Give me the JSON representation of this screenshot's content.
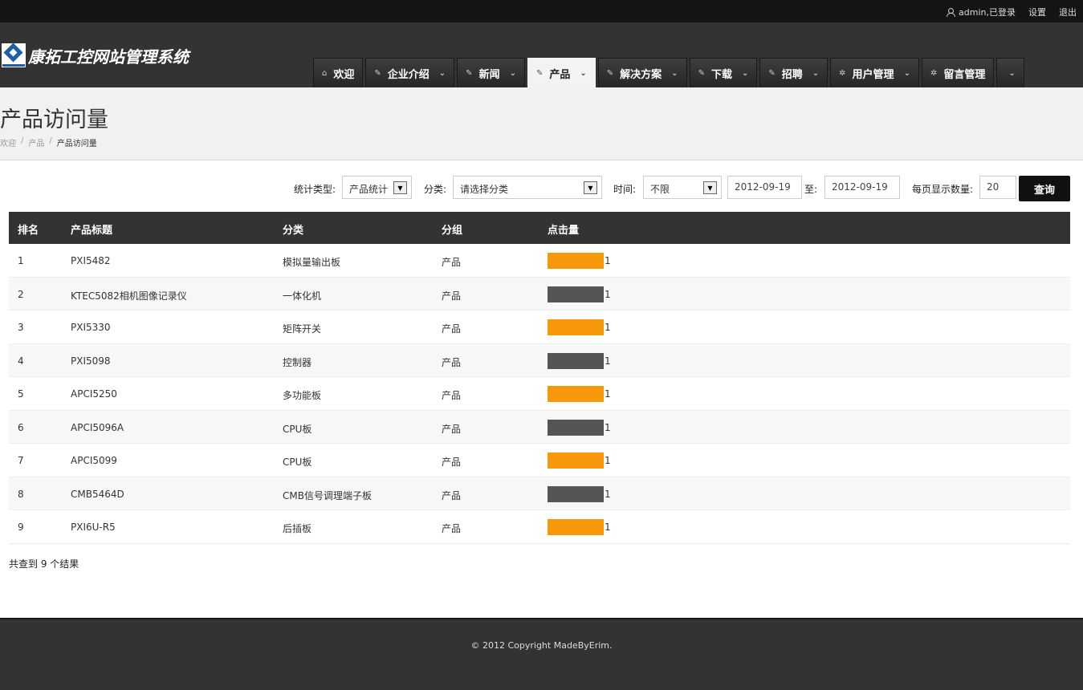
{
  "topbar": {
    "user": "admin,已登录",
    "settings": "设置",
    "logout": "退出"
  },
  "brand": {
    "name": "康拓工控网站管理系统"
  },
  "nav": [
    {
      "label": "欢迎",
      "icon": "home-icon",
      "glyph": "⌂",
      "dropdown": false,
      "active": false
    },
    {
      "label": "企业介绍",
      "icon": "pen-icon",
      "glyph": "✎",
      "dropdown": true,
      "active": false
    },
    {
      "label": "新闻",
      "icon": "pen-icon",
      "glyph": "✎",
      "dropdown": true,
      "active": false
    },
    {
      "label": "产品",
      "icon": "pen-icon",
      "glyph": "✎",
      "dropdown": true,
      "active": true
    },
    {
      "label": "解决方案",
      "icon": "pen-icon",
      "glyph": "✎",
      "dropdown": true,
      "active": false
    },
    {
      "label": "下载",
      "icon": "pen-icon",
      "glyph": "✎",
      "dropdown": true,
      "active": false
    },
    {
      "label": "招聘",
      "icon": "pen-icon",
      "glyph": "✎",
      "dropdown": true,
      "active": false
    },
    {
      "label": "用户管理",
      "icon": "gear-icon",
      "glyph": "✲",
      "dropdown": true,
      "active": false
    },
    {
      "label": "留言管理",
      "icon": "gear-icon",
      "glyph": "✲",
      "dropdown": false,
      "active": false
    },
    {
      "label": "",
      "icon": "",
      "glyph": "",
      "dropdown": true,
      "active": false
    }
  ],
  "page": {
    "title": "产品访问量"
  },
  "breadcrumb": {
    "home": "欢迎",
    "section": "产品",
    "current": "产品访问量",
    "sep": "/"
  },
  "filters": {
    "stat_type_label": "统计类型:",
    "stat_type_value": "产品统计",
    "category_label": "分类:",
    "category_value": "请选择分类",
    "time_label": "时间:",
    "time_value": "不限",
    "date_from": "2012-09-19",
    "to_label": "至:",
    "date_to": "2012-09-19",
    "per_page_label": "每页显示数量:",
    "per_page_value": "20",
    "query_button": "查询"
  },
  "table": {
    "headers": {
      "rank": "排名",
      "title": "产品标题",
      "category": "分类",
      "group": "分组",
      "clicks": "点击量"
    },
    "colors": {
      "odd": "#f7980a",
      "even": "#555555"
    },
    "rows": [
      {
        "rank": "1",
        "title": "PXI5482",
        "category": "模拟量输出板",
        "group": "产品",
        "clicks": "1"
      },
      {
        "rank": "2",
        "title": "KTEC5082相机图像记录仪",
        "category": "一体化机",
        "group": "产品",
        "clicks": "1"
      },
      {
        "rank": "3",
        "title": "PXI5330",
        "category": "矩阵开关",
        "group": "产品",
        "clicks": "1"
      },
      {
        "rank": "4",
        "title": "PXI5098",
        "category": "控制器",
        "group": "产品",
        "clicks": "1"
      },
      {
        "rank": "5",
        "title": "APCI5250",
        "category": "多功能板",
        "group": "产品",
        "clicks": "1"
      },
      {
        "rank": "6",
        "title": "APCI5096A",
        "category": "CPU板",
        "group": "产品",
        "clicks": "1"
      },
      {
        "rank": "7",
        "title": "APCI5099",
        "category": "CPU板",
        "group": "产品",
        "clicks": "1"
      },
      {
        "rank": "8",
        "title": "CMB5464D",
        "category": "CMB信号调理端子板",
        "group": "产品",
        "clicks": "1"
      },
      {
        "rank": "9",
        "title": "PXI6U-R5",
        "category": "后插板",
        "group": "产品",
        "clicks": "1"
      }
    ]
  },
  "summary": "共查到 9 个结果",
  "footer": {
    "copyright": "© 2012 Copyright MadeByErim."
  }
}
